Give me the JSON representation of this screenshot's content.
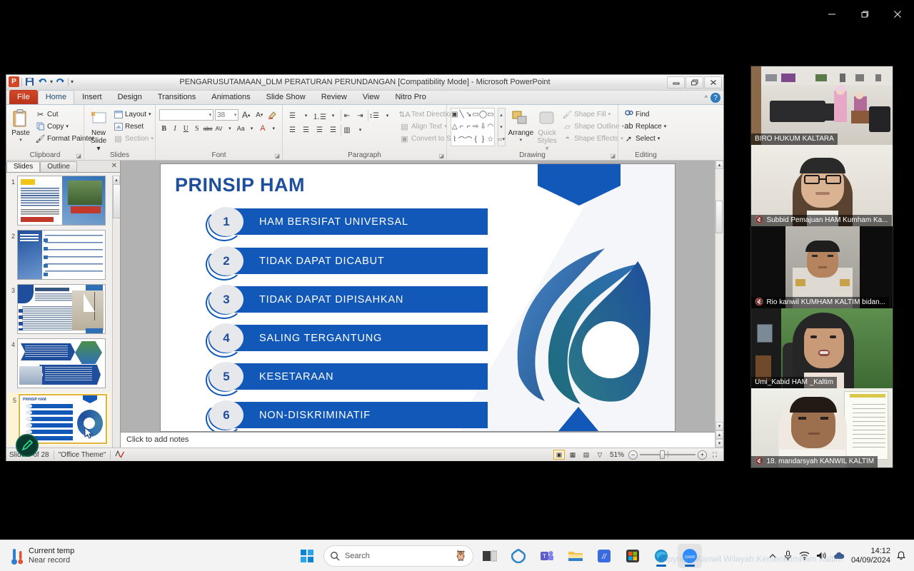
{
  "outer_window": {
    "minimize": "—",
    "restore": "❐",
    "close": "✕"
  },
  "powerpoint": {
    "title": "PENGARUSUTAMAAN_DLM PERATURAN PERUNDANGAN [Compatibility Mode]  -  Microsoft PowerPoint",
    "quick_access": [
      {
        "name": "app-logo",
        "label": "P"
      },
      {
        "name": "save",
        "label": "💾"
      },
      {
        "name": "undo",
        "label": "↺"
      },
      {
        "name": "redo",
        "label": "↻"
      },
      {
        "name": "customize",
        "label": "▾"
      }
    ],
    "window_controls": {
      "minimize": "▬",
      "restore": "❐",
      "close": "✕",
      "help": "?",
      "minimize_ribbon": "^"
    },
    "tabs": [
      {
        "label": "File",
        "type": "file"
      },
      {
        "label": "Home",
        "type": "active"
      },
      {
        "label": "Insert",
        "type": "normal"
      },
      {
        "label": "Design",
        "type": "normal"
      },
      {
        "label": "Transitions",
        "type": "normal"
      },
      {
        "label": "Animations",
        "type": "normal"
      },
      {
        "label": "Slide Show",
        "type": "normal"
      },
      {
        "label": "Review",
        "type": "normal"
      },
      {
        "label": "View",
        "type": "normal"
      },
      {
        "label": "Nitro Pro",
        "type": "normal"
      }
    ],
    "ribbon": {
      "clipboard": {
        "label": "Clipboard",
        "paste": "Paste",
        "items": [
          {
            "icon": "scissors-icon",
            "label": "Cut"
          },
          {
            "icon": "copy-icon",
            "label": "Copy"
          },
          {
            "icon": "format-painter-icon",
            "label": "Format Painter"
          }
        ]
      },
      "slides": {
        "label": "Slides",
        "new_slide": "New\nSlide",
        "new_slide_line1": "New",
        "new_slide_line2": "Slide",
        "items": [
          {
            "icon": "layout-icon",
            "label": "Layout"
          },
          {
            "icon": "reset-icon",
            "label": "Reset"
          },
          {
            "icon": "section-icon",
            "label": "Section",
            "disabled": true
          }
        ]
      },
      "font": {
        "label": "Font",
        "font_name": "",
        "font_size": "38",
        "grow": "A",
        "shrink": "A",
        "clear_format": "✄",
        "bold": "B",
        "italic": "I",
        "underline": "U",
        "shadow": "S",
        "strikethrough": "abc",
        "spacing": "AV",
        "change_case": "Aa",
        "font_color": "A"
      },
      "paragraph": {
        "label": "Paragraph",
        "items": [
          {
            "icon": "bullets-icon",
            "label": ""
          },
          {
            "icon": "numbering-icon",
            "label": ""
          },
          {
            "icon": "decrease-indent-icon",
            "label": ""
          },
          {
            "icon": "increase-indent-icon",
            "label": ""
          },
          {
            "icon": "line-spacing-icon",
            "label": ""
          }
        ],
        "right_items": [
          {
            "icon": "text-direction-icon",
            "label": "Text Direction"
          },
          {
            "icon": "align-text-icon",
            "label": "Align Text"
          },
          {
            "icon": "smartart-icon",
            "label": "Convert to SmartArt"
          }
        ],
        "align": [
          "align-left",
          "align-center",
          "align-right",
          "justify",
          "columns"
        ]
      },
      "drawing": {
        "label": "Drawing",
        "arrange": "Arrange",
        "quick_styles_l1": "Quick",
        "quick_styles_l2": "Styles",
        "items": [
          {
            "icon": "shape-fill-icon",
            "label": "Shape Fill"
          },
          {
            "icon": "shape-outline-icon",
            "label": "Shape Outline"
          },
          {
            "icon": "shape-effects-icon",
            "label": "Shape Effects"
          }
        ],
        "shapes": [
          "▣",
          "╲",
          "╲",
          "▭",
          "◯",
          "▭",
          "△",
          "⌐",
          "⌐",
          "⇨",
          "⇩",
          "◠",
          "⌇",
          "⌒",
          "⌒",
          "{",
          "}",
          "☆"
        ]
      },
      "editing": {
        "label": "Editing",
        "items": [
          {
            "icon": "find-icon",
            "label": "Find"
          },
          {
            "icon": "replace-icon",
            "label": "Replace"
          },
          {
            "icon": "select-icon",
            "label": "Select"
          }
        ]
      }
    },
    "slides_pane": {
      "tabs": [
        {
          "label": "Slides",
          "active": true
        },
        {
          "label": "Outline",
          "active": false
        }
      ],
      "close": "✕",
      "thumbnails": [
        {
          "number": "1",
          "selected": false,
          "kind": "cover"
        },
        {
          "number": "2",
          "selected": false,
          "kind": "landasan"
        },
        {
          "number": "3",
          "selected": false,
          "kind": "latar"
        },
        {
          "number": "4",
          "selected": false,
          "kind": "tujuan"
        },
        {
          "number": "5",
          "selected": true,
          "kind": "prinsip"
        }
      ]
    },
    "notes_placeholder": "Click to add notes",
    "status": {
      "slide_label": "Slide 5 of 28",
      "theme": "\"Office Theme\"",
      "language_icon": "spell-check-icon",
      "zoom_level": "51%",
      "zoom_out": "−",
      "zoom_in": "+",
      "fit_slide": "⛶",
      "views": [
        "normal-view",
        "slide-sorter-view",
        "reading-view",
        "slide-show-view"
      ]
    },
    "slide": {
      "title": "PRINSIP HAM",
      "items": [
        {
          "number": "1",
          "text": "HAM  BERSIFAT UNIVERSAL"
        },
        {
          "number": "2",
          "text": "TIDAK DAPAT DICABUT"
        },
        {
          "number": "3",
          "text": "TIDAK DAPAT DIPISAHKAN"
        },
        {
          "number": "4",
          "text": "SALING TERGANTUNG"
        },
        {
          "number": "5",
          "text": "KESETARAAN"
        },
        {
          "number": "6",
          "text": "NON-DISKRIMINATIF"
        }
      ],
      "colors": {
        "accent_blue": "#1258b8",
        "title_blue": "#1f4e9c",
        "circle_gray": "#e6e8ec"
      }
    }
  },
  "zoom_meeting": {
    "participants": [
      {
        "name": "BIRO HUKUM KALTARA",
        "muted": false,
        "active": false,
        "scene": "room"
      },
      {
        "name": "Subbid Pemajuan HAM Kumham Ka...",
        "muted": true,
        "active": false,
        "scene": "man-glasses"
      },
      {
        "name": "Rio kanwil KUMHAM KALTIM bidan...",
        "muted": true,
        "active": false,
        "scene": "man-uniform"
      },
      {
        "name": "Umi_Kabid HAM _Kaltim",
        "muted": false,
        "active": true,
        "scene": "woman-hijab"
      },
      {
        "name": "18. mandarsyah KANWIL KALTIM",
        "muted": true,
        "active": false,
        "scene": "man-white"
      }
    ],
    "active_color": "#2ce08f",
    "mute_color": "#e8453c"
  },
  "taskbar": {
    "weather": {
      "title": "Current temp",
      "subtitle": "Near record",
      "icon": "thermometer-icon"
    },
    "search": {
      "placeholder": "Search",
      "icon": "search-icon",
      "mascot": "owl-icon"
    },
    "start": {
      "name": "start-button"
    },
    "apps": [
      {
        "name": "task-view",
        "label": "❑",
        "running": false
      },
      {
        "name": "copilot",
        "label": "✺",
        "running": false
      },
      {
        "name": "teams",
        "label": "T",
        "running": false
      },
      {
        "name": "file-explorer",
        "label": "📁",
        "running": false
      },
      {
        "name": "media-app",
        "label": "//",
        "running": false
      },
      {
        "name": "microsoft-store",
        "label": "▦",
        "running": false
      },
      {
        "name": "edge",
        "label": "e",
        "running": true
      },
      {
        "name": "zoom",
        "label": "zoom",
        "running": true
      }
    ],
    "tray": [
      {
        "name": "show-hidden-icons",
        "label": "^"
      },
      {
        "name": "microphone-icon",
        "label": "🎤"
      },
      {
        "name": "wifi-icon",
        "label": "wifi"
      },
      {
        "name": "volume-icon",
        "label": "🔊"
      },
      {
        "name": "onedrive-icon",
        "label": "☁"
      }
    ],
    "clock": {
      "time": "14:12",
      "date": "04/09/2024"
    },
    "notification": {
      "name": "notification-bell",
      "label": "🔔"
    }
  },
  "watermark": "Copyright Kanwil Wilayah Kemenkumham Kaltim"
}
